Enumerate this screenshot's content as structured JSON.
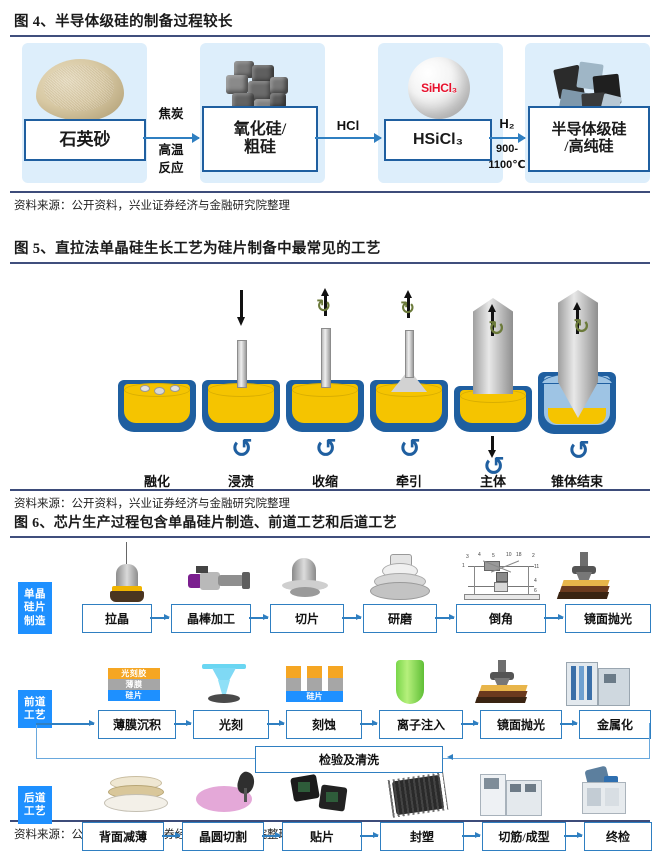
{
  "figure4": {
    "title": "图 4、半导体级硅的制备过程较长",
    "source": "资料来源：公开资料，兴业证券经济与金融研究院整理",
    "stages": [
      {
        "label": "石英砂",
        "icon": "quartz-sand-photo"
      },
      {
        "label": "氧化硅/\n粗硅",
        "label_line1": "氧化硅/",
        "label_line2": "粗硅",
        "icon": "silica-rock-photo"
      },
      {
        "label": "HSiCl₃",
        "icon": "sihcl3-bubble",
        "bubble_text": "SiHCl₃"
      },
      {
        "label": "半导体级硅\n/高纯硅",
        "label_line1": "半导体级硅",
        "label_line2": "/高纯硅",
        "icon": "polysilicon-chunk-photo"
      }
    ],
    "transitions": [
      {
        "line1": "焦炭",
        "line2": "高温",
        "line3": "反应"
      },
      {
        "line1": "HCl",
        "line2": "",
        "line3": ""
      },
      {
        "line1": "H₂",
        "line2": "900-",
        "line3": "1100℃"
      }
    ],
    "colors": {
      "panel": "#ddeefb",
      "box_border": "#1f5fa0",
      "arrow": "#2f7fc1"
    }
  },
  "figure5": {
    "title": "图 5、直拉法单晶硅生长工艺为硅片制备中最常见的工艺",
    "source": "资料来源：公开资料，兴业证券经济与金融研究院整理",
    "steps": [
      {
        "label": "融化",
        "stage": "melt"
      },
      {
        "label": "浸渍",
        "stage": "dip"
      },
      {
        "label": "收缩",
        "stage": "neck"
      },
      {
        "label": "牵引",
        "stage": "crown"
      },
      {
        "label": "主体",
        "stage": "body"
      },
      {
        "label": "锥体结束",
        "stage": "tail"
      }
    ],
    "colors": {
      "crucible": "#1f5fa0",
      "melt": "#f5c400",
      "rod": "#cfcfcf"
    }
  },
  "figure6": {
    "title": "图 6、芯片生产过程包含单晶硅片制造、前道工艺和后道工艺",
    "source": "资料来源：公开资料，兴业证券经济与金融研究院整理",
    "rows": [
      {
        "label_lines": [
          "单晶",
          "硅片",
          "制造"
        ],
        "steps": [
          {
            "label": "拉晶",
            "icon": "crystal-puller-photo"
          },
          {
            "label": "晶棒加工",
            "icon": "ingot-grinder-photo"
          },
          {
            "label": "切片",
            "icon": "wire-saw-photo"
          },
          {
            "label": "研磨",
            "icon": "lapping-machine-photo"
          },
          {
            "label": "倒角",
            "icon": "edge-grinding-diagram"
          },
          {
            "label": "镜面抛光",
            "icon": "polisher-photo"
          }
        ]
      },
      {
        "label_lines": [
          "前道",
          "工艺"
        ],
        "steps": [
          {
            "label": "薄膜沉积",
            "icon": "film-stack-diagram"
          },
          {
            "label": "光刻",
            "icon": "lithography-beam"
          },
          {
            "label": "刻蚀",
            "icon": "etch-pattern-diagram"
          },
          {
            "label": "离子注入",
            "icon": "ion-implant-tube"
          },
          {
            "label": "镜面抛光",
            "icon": "cmp-polisher-photo"
          },
          {
            "label": "金属化",
            "icon": "metallization-tool-photo"
          }
        ],
        "feedback": {
          "label": "检验及清洗"
        }
      },
      {
        "label_lines": [
          "后道",
          "工艺"
        ],
        "steps": [
          {
            "label": "背面减薄",
            "icon": "wafer-thinning-photo"
          },
          {
            "label": "晶圆切割",
            "icon": "wafer-dicing-photo"
          },
          {
            "label": "贴片",
            "icon": "die-attach-photo"
          },
          {
            "label": "封塑",
            "icon": "molded-package-photo"
          },
          {
            "label": "切筋/成型",
            "icon": "trim-form-machine-photo"
          },
          {
            "label": "终检",
            "icon": "final-test-machine-photo"
          }
        ]
      }
    ],
    "film_stack": [
      {
        "label": "光刻胶",
        "color": "#f5a623"
      },
      {
        "label": "薄膜",
        "color": "#a6a6a6"
      },
      {
        "label": "硅片",
        "color": "#1e90ff"
      }
    ],
    "etch_stack": [
      {
        "label": "硅片",
        "color": "#1e90ff"
      }
    ],
    "bevel_numbers": [
      "3",
      "4",
      "5",
      "10",
      "18",
      "2",
      "1",
      "11",
      "4",
      "6"
    ],
    "colors": {
      "row_label_bg": "#1e90ff",
      "box_border": "#2f7fc1",
      "arrow": "#2f7fc1"
    }
  }
}
